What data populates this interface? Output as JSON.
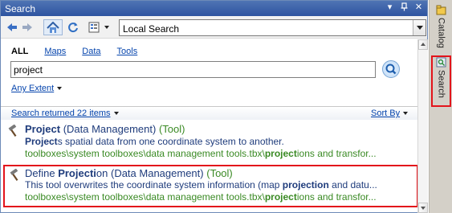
{
  "window": {
    "title": "Search"
  },
  "toolbar": {
    "location": "Local Search"
  },
  "tabs": [
    {
      "label": "ALL",
      "active": true
    },
    {
      "label": "Maps",
      "active": false
    },
    {
      "label": "Data",
      "active": false
    },
    {
      "label": "Tools",
      "active": false
    }
  ],
  "search": {
    "query": "project",
    "extent": "Any Extent"
  },
  "results_header": {
    "count_text": "Search returned 22 items",
    "sort_label": "Sort By"
  },
  "results": [
    {
      "name_bold": "Project",
      "name_rest": "",
      "category": "(Data Management)",
      "kind": "(Tool)",
      "desc_bold": "Project",
      "desc_rest": "s spatial data from one coordinate system to another.",
      "path_pre": "toolboxes\\system toolboxes\\data management tools.tbx\\",
      "path_bold": "project",
      "path_post": "ions and transfor..."
    },
    {
      "name_pre": "Define ",
      "name_bold": "Projecti",
      "name_rest": "on",
      "category": "(Data Management)",
      "kind": "(Tool)",
      "desc_pre": "This tool overwrites the coordinate system information (map ",
      "desc_bold": "projection",
      "desc_rest": " and datu...",
      "path_pre": "toolboxes\\system toolboxes\\data management tools.tbx\\",
      "path_bold": "project",
      "path_post": "ions and transfor..."
    }
  ],
  "dock": {
    "catalog_label": "Catalog",
    "search_label": "Search"
  },
  "colors": {
    "highlight": "#e3141b",
    "title_bar": "#3a5fa8",
    "link": "#0645ad",
    "path_green": "#3a8a24"
  }
}
